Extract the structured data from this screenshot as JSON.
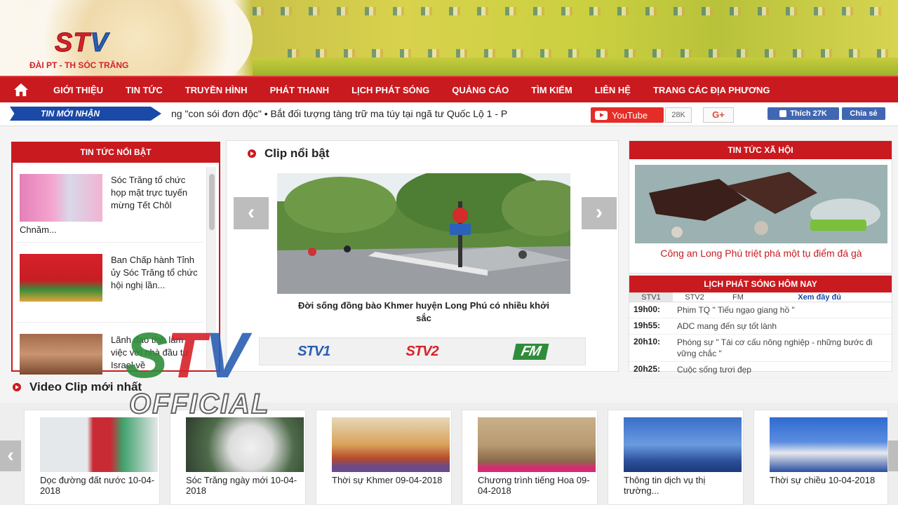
{
  "header": {
    "logo_text_a": "ST",
    "logo_text_b": "V",
    "tagline": "ĐÀI PT - TH SÓC TRĂNG"
  },
  "nav": {
    "items": [
      "Giới thiệu",
      "Tin tức",
      "Truyền hình",
      "Phát thanh",
      "Lịch phát sóng",
      "Quảng cáo",
      "Tìm kiếm",
      "Liên hệ",
      "Trang các địa phương"
    ]
  },
  "ticker": {
    "label": "TIN MỚI NHẬN",
    "text": "ng \"con sói đơn độc\"   •  Bắt đối tượng tàng trữ ma túy tại ngã tư Quốc Lộ 1 - P",
    "youtube_label": "YouTube",
    "youtube_count": "28K",
    "gplus_label": "G+",
    "fb_like_label": "Thích 27K",
    "fb_share_label": "Chia sẻ"
  },
  "featured": {
    "heading": "TIN TỨC NỔI BẬT",
    "items": [
      {
        "title": "Sóc Trăng tổ chức họp mặt trực tuyến mừng Tết Chôl",
        "extra": "Chnăm..."
      },
      {
        "title": "Ban Chấp hành Tỉnh ủy Sóc Trăng tổ chức hội nghị lần...",
        "extra": ""
      },
      {
        "title": "Lãnh đạo tỉnh làm việc với nhà đầu tư Israel về",
        "extra": ""
      }
    ]
  },
  "clip": {
    "heading": "Clip nổi bật",
    "caption": "Đời sống đồng bào Khmer huyện Long Phú có nhiều khởi sắc",
    "channels": [
      "STV1",
      "STV2",
      "FM"
    ]
  },
  "social_news": {
    "heading": "TIN TỨC XÃ HỘI",
    "caption": "Công an Long Phú triệt phá một tụ điểm đá gà"
  },
  "schedule": {
    "heading": "LỊCH PHÁT SÓNG HÔM NAY",
    "tabs": [
      "STV1",
      "STV2",
      "FM"
    ],
    "more": "Xem đầy đủ",
    "rows": [
      {
        "time": "19h00:",
        "program": "Phim TQ \" Tiếu ngạo giang hồ \""
      },
      {
        "time": "19h55:",
        "program": "ADC mang đến sự tốt lành"
      },
      {
        "time": "20h10:",
        "program": "Phóng sự \" Tái cơ cấu nông nghiệp - những bước đi vững chắc \""
      },
      {
        "time": "20h25:",
        "program": "Cuộc sống tươi đẹp"
      }
    ]
  },
  "videos": {
    "heading": "Video Clip mới nhất",
    "items": [
      {
        "title": "Dọc đường đất nước 10-04-2018"
      },
      {
        "title": "Sóc Trăng ngày mới 10-04-2018"
      },
      {
        "title": "Thời sự Khmer 09-04-2018"
      },
      {
        "title": "Chương trình tiếng Hoa 09-04-2018"
      },
      {
        "title": "Thông tin dịch vụ thị trường..."
      },
      {
        "title": "Thời sự chiều 10-04-2018"
      }
    ]
  },
  "watermark": {
    "s": "S",
    "t": "T",
    "v": "V",
    "official": "OFFICIAL"
  },
  "colors": {
    "brand_red": "#c91a1f",
    "brand_blue": "#1a49a7",
    "youtube_red": "#e52d27",
    "facebook_blue": "#4267b2"
  }
}
